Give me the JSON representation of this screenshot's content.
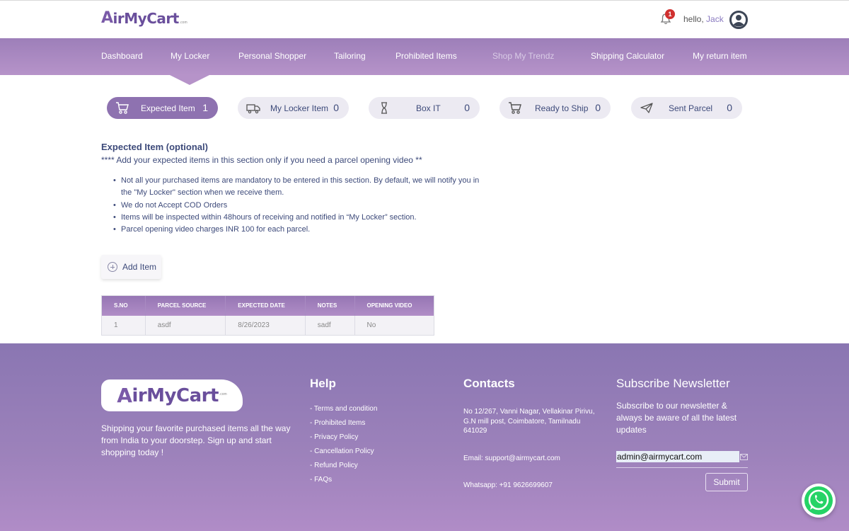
{
  "header": {
    "logo_text": "irMyCart",
    "logo_a": "A",
    "logo_suffix": ".com",
    "notification_count": "1",
    "greeting": "hello, ",
    "username": "Jack"
  },
  "nav": {
    "items": [
      {
        "label": "Dashboard"
      },
      {
        "label": "My Locker"
      },
      {
        "label": "Personal Shopper"
      },
      {
        "label": "Tailoring"
      },
      {
        "label": "Prohibited Items"
      },
      {
        "label": "Shop My Trendz"
      },
      {
        "label": "Shipping Calculator"
      },
      {
        "label": "My return item"
      }
    ]
  },
  "tabs": [
    {
      "label": "Expected Item",
      "count": "1",
      "icon": "cart-icon",
      "active": true
    },
    {
      "label": "My Locker Item",
      "count": "0",
      "icon": "truck-icon"
    },
    {
      "label": "Box IT",
      "count": "0",
      "icon": "hourglass-icon"
    },
    {
      "label": "Ready to Ship",
      "count": "0",
      "icon": "cart-icon"
    },
    {
      "label": "Sent Parcel",
      "count": "0",
      "icon": "send-icon"
    }
  ],
  "content": {
    "title": "Expected Item (optional)",
    "subtitle": "**** Add your expected items in this section only if you need a parcel opening video **",
    "bullets": [
      "Not all your purchased items are mandatory to be entered in this section. By default, we will notify you in the \"My Locker\" section when we receive them.",
      "We do not Accept COD Orders",
      "Items will be inspected within 48hours of receiving and notified in “My Locker” section.",
      "Parcel opening video charges INR 100 for each parcel."
    ],
    "add_button": "Add Item"
  },
  "table": {
    "headers": [
      "S.NO",
      "PARCEL SOURCE",
      "EXPECTED DATE",
      "NOTES",
      "OPENING VIDEO"
    ],
    "rows": [
      [
        "1",
        "asdf",
        "8/26/2023",
        "sadf",
        "No"
      ]
    ]
  },
  "footer": {
    "tagline": "Shipping your favorite purchased items all the way from India to your doorstep. Sign up and start shopping today !",
    "help_title": "Help",
    "help_links": [
      "- Terms and condition",
      "- Prohibited Items",
      "- Privacy Policy",
      "- Cancellation Policy",
      "- Refund Policy",
      "- FAQs"
    ],
    "contacts_title": "Contacts",
    "address": "No 12/267, Vanni Nagar, Vellakinar Pirivu, G.N mill post, Coimbatore, Tamilnadu 641029",
    "email": "Email: support@airmycart.com",
    "whatsapp": "Whatsapp: +91 9626699607",
    "newsletter_title": "Subscribe Newsletter",
    "newsletter_text": "Subscribe to our newsletter & always be aware of all the latest updates",
    "newsletter_value": "admin@airmycart.com",
    "submit_label": "Submit"
  },
  "colors": {
    "brand_purple": "#8e72b0",
    "text_navy": "#3d4a7a",
    "badge_red": "#d0302f",
    "whatsapp_green": "#25d366"
  }
}
